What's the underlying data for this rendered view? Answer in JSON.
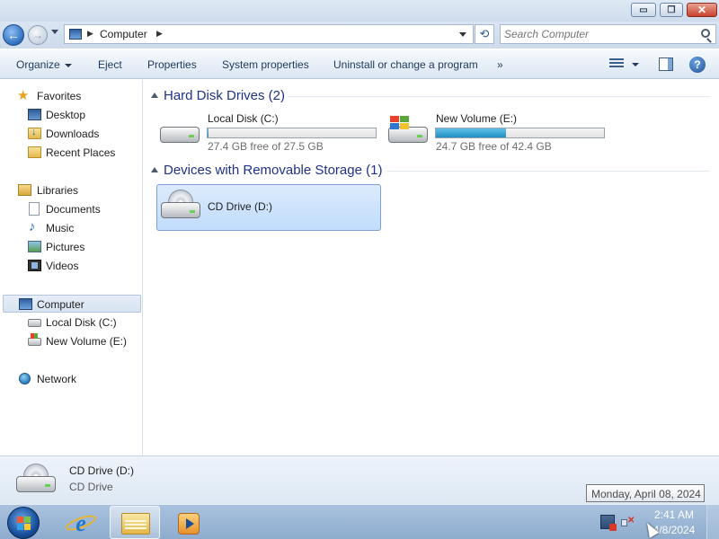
{
  "window": {
    "minimize_glyph": "▭",
    "maximize_glyph": "❐",
    "close_glyph": "✕"
  },
  "navigation": {
    "back_glyph": "←",
    "forward_glyph": "→",
    "breadcrumb": [
      "Computer"
    ],
    "refresh_glyph": "⟲",
    "search_placeholder": "Search Computer"
  },
  "toolbar": {
    "organize_label": "Organize",
    "eject_label": "Eject",
    "properties_label": "Properties",
    "system_properties_label": "System properties",
    "uninstall_label": "Uninstall or change a program",
    "more_label": "»",
    "help_glyph": "?"
  },
  "sidebar": {
    "favorites": {
      "label": "Favorites",
      "items": [
        {
          "label": "Desktop",
          "icon": "desktop-icon"
        },
        {
          "label": "Downloads",
          "icon": "downloads-icon"
        },
        {
          "label": "Recent Places",
          "icon": "recent-places-icon"
        }
      ]
    },
    "libraries": {
      "label": "Libraries",
      "items": [
        {
          "label": "Documents",
          "icon": "documents-icon"
        },
        {
          "label": "Music",
          "icon": "music-icon"
        },
        {
          "label": "Pictures",
          "icon": "pictures-icon"
        },
        {
          "label": "Videos",
          "icon": "videos-icon"
        }
      ]
    },
    "computer": {
      "label": "Computer",
      "selected": true,
      "items": [
        {
          "label": "Local Disk (C:)",
          "icon": "drive-icon"
        },
        {
          "label": "New Volume (E:)",
          "icon": "windows-drive-icon"
        }
      ]
    },
    "network": {
      "label": "Network"
    }
  },
  "main": {
    "groups": [
      {
        "header": "Hard Disk Drives (2)",
        "drives": [
          {
            "name": "Local Disk (C:)",
            "free_text": "27.4 GB free of 27.5 GB",
            "used_fraction": 0.004,
            "icon": "drive-icon"
          },
          {
            "name": "New Volume (E:)",
            "free_text": "24.7 GB free of 42.4 GB",
            "used_fraction": 0.417,
            "icon": "windows-drive-icon"
          }
        ]
      },
      {
        "header": "Devices with Removable Storage (1)",
        "drives": [
          {
            "name": "CD Drive (D:)",
            "icon": "cd-drive-icon",
            "selected": true
          }
        ]
      }
    ]
  },
  "details_pane": {
    "name": "CD Drive (D:)",
    "type": "CD Drive"
  },
  "tooltip": {
    "text": "Monday, April 08, 2024"
  },
  "taskbar": {
    "time": "2:41 AM",
    "date": "4/8/2024",
    "ie_glyph": "e"
  },
  "colors": {
    "accent": "#1e3287",
    "progress_fill": "#1f8fc4",
    "selection": "#c1dcfc"
  }
}
